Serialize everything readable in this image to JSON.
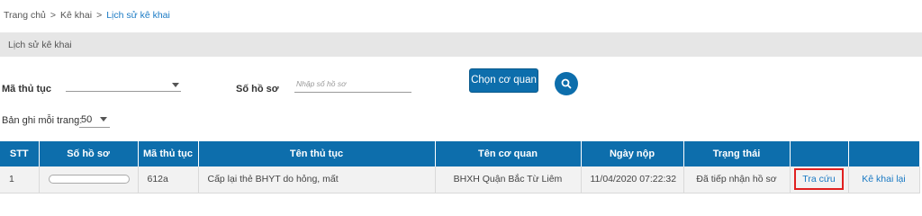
{
  "breadcrumb": {
    "home": "Trang chủ",
    "separator1": ">",
    "declare": "Kê khai",
    "separator2": ">",
    "current": "Lịch sử kê khai"
  },
  "section_title": "Lịch sử kê khai",
  "filters": {
    "procedure_code_label": "Mã thủ tục",
    "procedure_code_value": "",
    "dossier_no_label": "Số hồ sơ",
    "dossier_no_placeholder": "Nhập số hồ sơ",
    "choose_agency_button": "Chọn cơ quan",
    "search_icon": "search-icon"
  },
  "pagination": {
    "per_page_label": "Bản ghi mỗi trang:",
    "per_page_value": "50"
  },
  "table": {
    "columns": [
      "STT",
      "Số hồ sơ",
      "Mã thủ tục",
      "Tên thủ tục",
      "Tên cơ quan",
      "Ngày nộp",
      "Trạng thái",
      "",
      ""
    ],
    "rows": [
      {
        "stt": "1",
        "dossier_no": "",
        "procedure_code": "612a",
        "procedure_name": "Cấp lại thẻ BHYT do hỏng, mất",
        "agency": "BHXH Quận Bắc Từ Liêm",
        "submitted": "11/04/2020 07:22:32",
        "status": "Đã tiếp nhận hồ sơ",
        "lookup_action": "Tra cứu",
        "redeclare_action": "Kê khai lại"
      }
    ]
  },
  "colors": {
    "primary": "#0d6eac",
    "link": "#1a7ac4",
    "highlight_border": "#e02020",
    "section_bar": "#e6e6e6"
  }
}
